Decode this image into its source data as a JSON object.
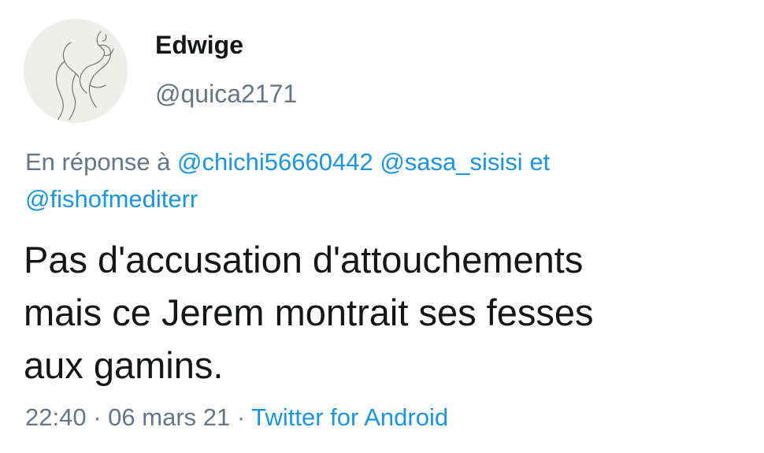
{
  "tweet": {
    "author": {
      "display_name": "Edwige",
      "username": "@quica2171"
    },
    "reply": {
      "prefix": "En réponse à",
      "mention_1": "@chichi56660442",
      "mention_2": "@sasa_sisisi",
      "conjunction": "et",
      "mention_3": "@fishofmediterr"
    },
    "text_lines": [
      "Pas d'accusation d'attouchements",
      "mais ce Jerem montrait ses fesses",
      "aux gamins."
    ],
    "meta": {
      "time": "22:40",
      "separator": "·",
      "date": "06 mars 21",
      "source": "Twitter for Android"
    },
    "colors": {
      "link": "#1b95e0",
      "secondary": "#657786",
      "primary": "#14171a",
      "avatar_bg": "#efeee9"
    }
  }
}
